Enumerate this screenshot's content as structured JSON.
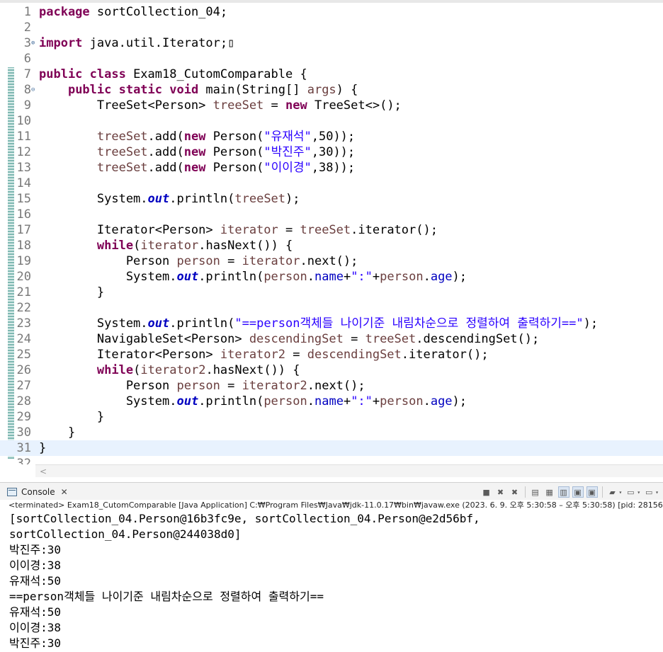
{
  "editor": {
    "lines": [
      {
        "n": "1",
        "fold": "",
        "html": "<span class=\"kw\">package</span> sortCollection_04;"
      },
      {
        "n": "2",
        "fold": "",
        "html": ""
      },
      {
        "n": "3",
        "fold": "⊕",
        "html": "<span class=\"kw\">import</span> java.util.Iterator;▯"
      },
      {
        "n": "6",
        "fold": "",
        "html": ""
      },
      {
        "n": "7",
        "fold": "",
        "html": "<span class=\"kw\">public class</span> Exam18_CutomComparable {"
      },
      {
        "n": "8",
        "fold": "⊖",
        "html": "    <span class=\"kw\">public static void</span> main(String[] <span class=\"loc\">args</span>) {"
      },
      {
        "n": "9",
        "fold": "",
        "html": "        TreeSet&lt;Person&gt; <span class=\"loc\">treeSet</span> = <span class=\"kw\">new</span> TreeSet&lt;&gt;();"
      },
      {
        "n": "10",
        "fold": "",
        "html": ""
      },
      {
        "n": "11",
        "fold": "",
        "html": "        <span class=\"loc\">treeSet</span>.add(<span class=\"kw\">new</span> Person(<span class=\"str\">\"유재석\"</span>,50));"
      },
      {
        "n": "12",
        "fold": "",
        "html": "        <span class=\"loc\">treeSet</span>.add(<span class=\"kw\">new</span> Person(<span class=\"str\">\"박진주\"</span>,30));"
      },
      {
        "n": "13",
        "fold": "",
        "html": "        <span class=\"loc\">treeSet</span>.add(<span class=\"kw\">new</span> Person(<span class=\"str\">\"이이경\"</span>,38));"
      },
      {
        "n": "14",
        "fold": "",
        "html": ""
      },
      {
        "n": "15",
        "fold": "",
        "html": "        System.<span class=\"sfld\">out</span>.println(<span class=\"loc\">treeSet</span>);"
      },
      {
        "n": "16",
        "fold": "",
        "html": ""
      },
      {
        "n": "17",
        "fold": "",
        "html": "        Iterator&lt;Person&gt; <span class=\"loc\">iterator</span> = <span class=\"loc\">treeSet</span>.iterator();"
      },
      {
        "n": "18",
        "fold": "",
        "html": "        <span class=\"kw\">while</span>(<span class=\"loc\">iterator</span>.hasNext()) {"
      },
      {
        "n": "19",
        "fold": "",
        "html": "            Person <span class=\"loc\">person</span> = <span class=\"loc\">iterator</span>.next();"
      },
      {
        "n": "20",
        "fold": "",
        "html": "            System.<span class=\"sfld\">out</span>.println(<span class=\"loc\">person</span>.<span class=\"fld\">name</span>+<span class=\"str\">\":\"</span>+<span class=\"loc\">person</span>.<span class=\"fld\">age</span>);"
      },
      {
        "n": "21",
        "fold": "",
        "html": "        }"
      },
      {
        "n": "22",
        "fold": "",
        "html": ""
      },
      {
        "n": "23",
        "fold": "",
        "html": "        System.<span class=\"sfld\">out</span>.println(<span class=\"str\">\"==person객체들 나이기준 내림차순으로 정렬하여 출력하기==\"</span>);"
      },
      {
        "n": "24",
        "fold": "",
        "html": "        NavigableSet&lt;Person&gt; <span class=\"loc\">descendingSet</span> = <span class=\"loc\">treeSet</span>.descendingSet();"
      },
      {
        "n": "25",
        "fold": "",
        "html": "        Iterator&lt;Person&gt; <span class=\"loc\">iterator2</span> = <span class=\"loc\">descendingSet</span>.iterator();"
      },
      {
        "n": "26",
        "fold": "",
        "html": "        <span class=\"kw\">while</span>(<span class=\"loc\">iterator2</span>.hasNext()) {"
      },
      {
        "n": "27",
        "fold": "",
        "html": "            Person <span class=\"loc\">person</span> = <span class=\"loc\">iterator2</span>.next();"
      },
      {
        "n": "28",
        "fold": "",
        "html": "            System.<span class=\"sfld\">out</span>.println(<span class=\"loc\">person</span>.<span class=\"fld\">name</span>+<span class=\"str\">\":\"</span>+<span class=\"loc\">person</span>.<span class=\"fld\">age</span>);"
      },
      {
        "n": "29",
        "fold": "",
        "html": "        }"
      },
      {
        "n": "30",
        "fold": "",
        "html": "    }"
      },
      {
        "n": "31",
        "fold": "",
        "html": "}"
      },
      {
        "n": "32",
        "fold": "",
        "html": ""
      }
    ],
    "current_line": "31"
  },
  "scrollbar": {
    "left_arrow": "<"
  },
  "console": {
    "tab_label": "Console",
    "tab_close": "✕",
    "status": "<terminated> Exam18_CutomComparable [Java Application] C:₩Program Files₩Java₩jdk-11.0.17₩bin₩javaw.exe  (2023. 6. 9. 오후 5:30:58 – 오후 5:30:58) [pid: 28156]",
    "output": [
      "[sortCollection_04.Person@16b3fc9e, sortCollection_04.Person@e2d56bf,",
      "sortCollection_04.Person@244038d0]",
      "박진주:30",
      "이이경:38",
      "유재석:50",
      "==person객체들 나이기준 내림차순으로 정렬하여 출력하기==",
      "유재석:50",
      "이이경:38",
      "박진주:30"
    ],
    "toolbar": [
      {
        "name": "terminate-icon",
        "glyph": "■",
        "on": false
      },
      {
        "name": "remove-launch-icon",
        "glyph": "✖",
        "on": false
      },
      {
        "name": "remove-all-terminated-icon",
        "glyph": "✖",
        "on": false
      },
      {
        "name": "clear-console-icon",
        "glyph": "▤",
        "on": false
      },
      {
        "name": "scroll-lock-icon",
        "glyph": "▦",
        "on": false
      },
      {
        "name": "word-wrap-icon",
        "glyph": "▥",
        "on": true
      },
      {
        "name": "show-on-stdout-icon",
        "glyph": "▣",
        "on": true
      },
      {
        "name": "show-on-stderr-icon",
        "glyph": "▣",
        "on": true
      },
      {
        "name": "pin-console-icon",
        "glyph": "▰",
        "on": false
      },
      {
        "name": "display-console-icon",
        "glyph": "▭",
        "on": false
      },
      {
        "name": "open-console-icon",
        "glyph": "▭",
        "on": false
      }
    ]
  }
}
